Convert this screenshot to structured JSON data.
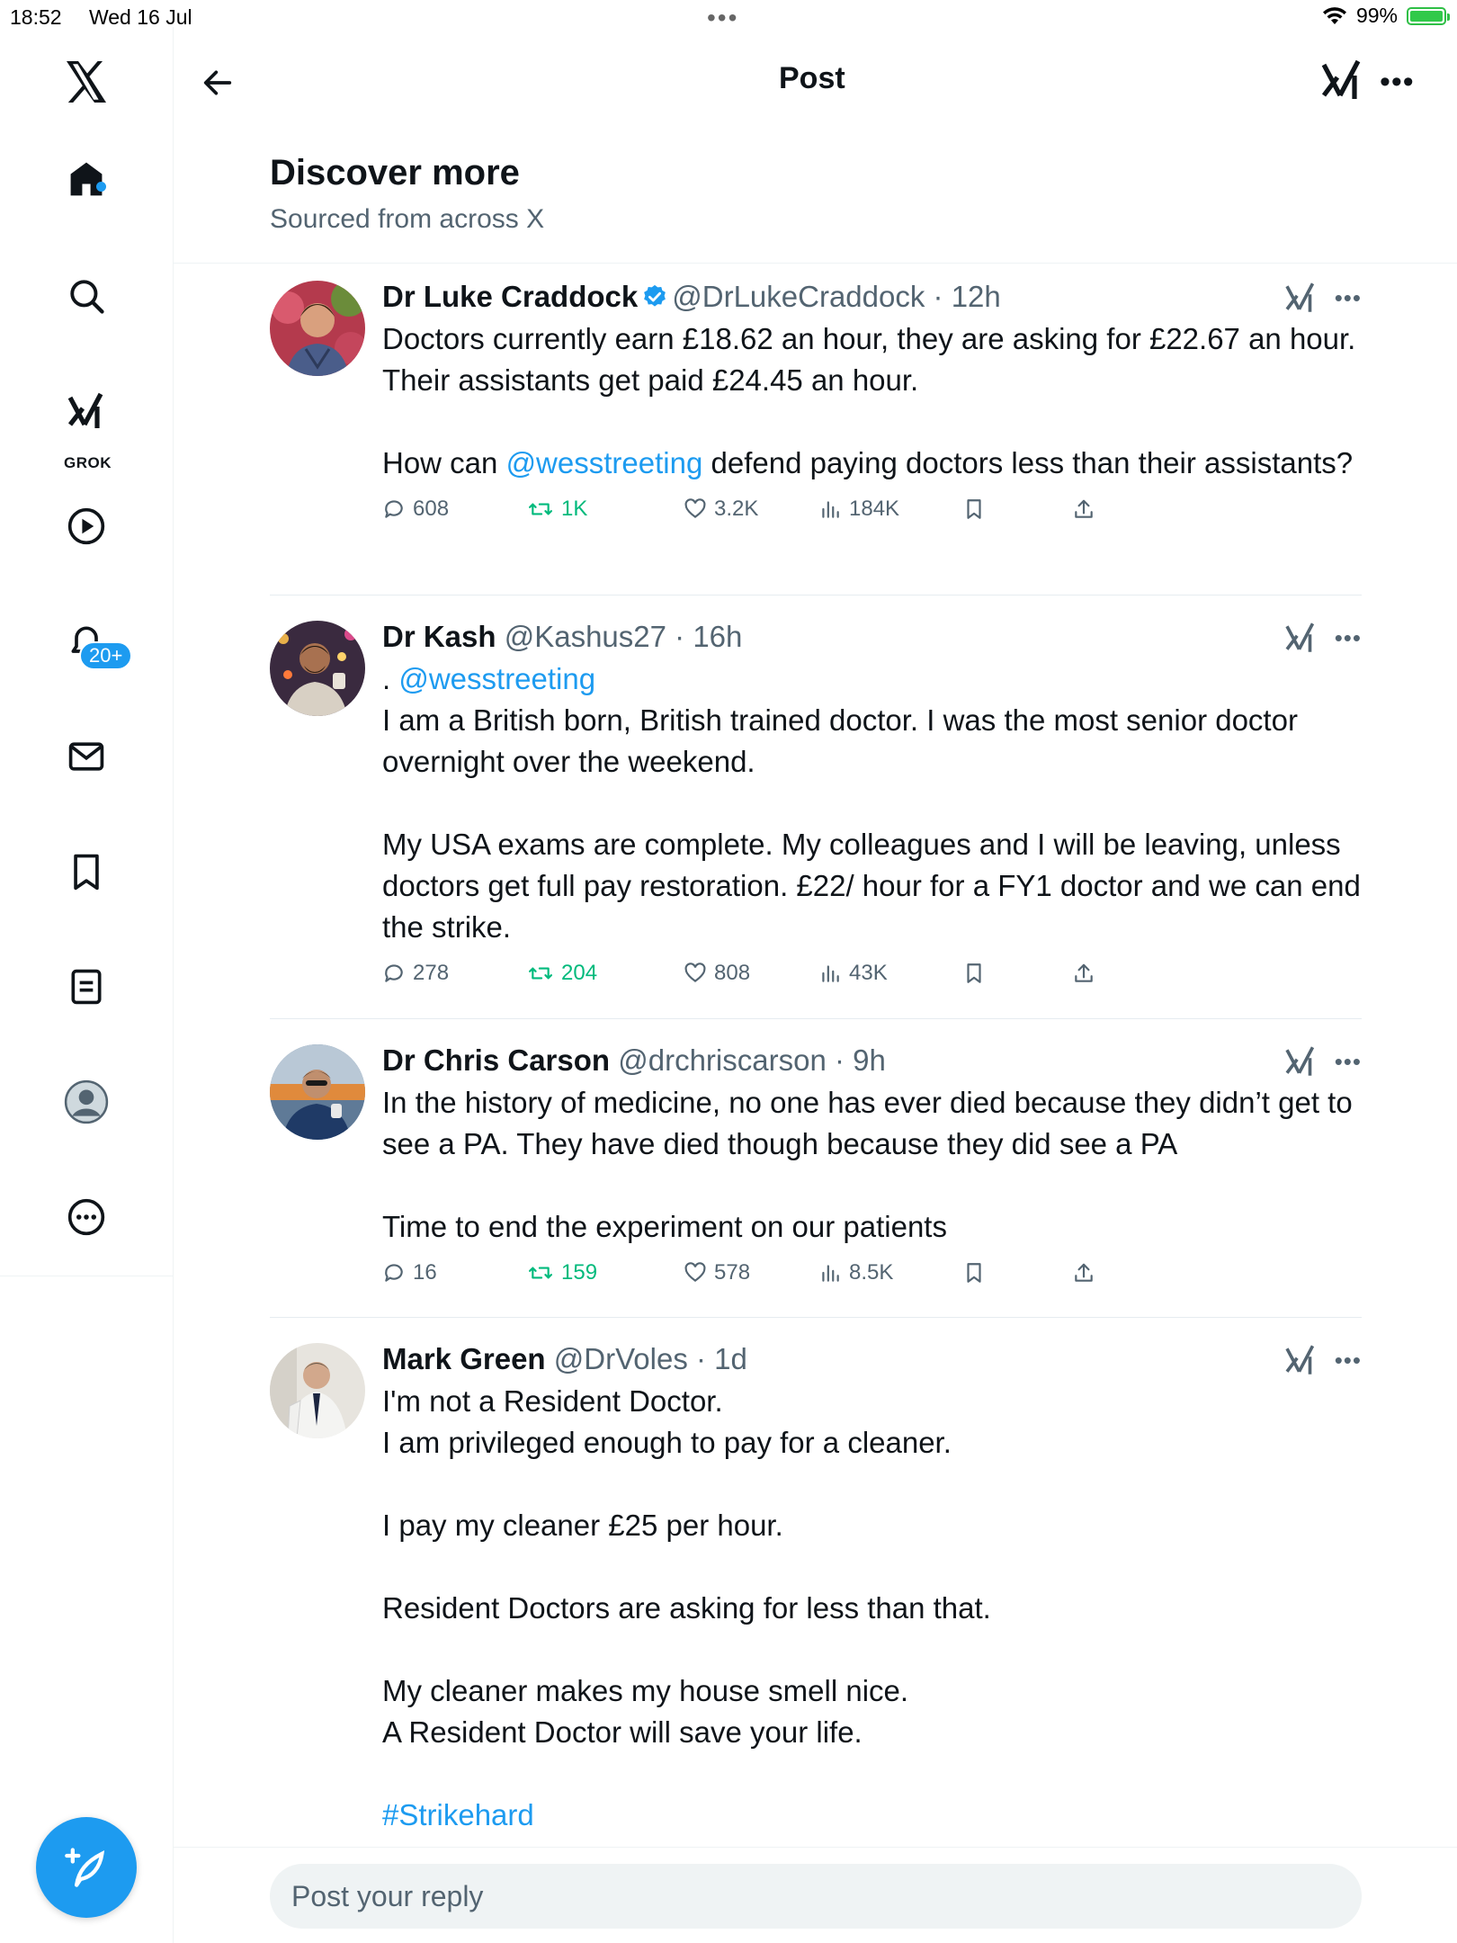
{
  "status_bar": {
    "time": "18:52",
    "date": "Wed 16 Jul",
    "battery": "99%",
    "battery_level": 0.99
  },
  "sidebar": {
    "grok_label": "GROK",
    "notifications_badge": "20+"
  },
  "header": {
    "title": "Post"
  },
  "discover": {
    "title": "Discover more",
    "subtitle": "Sourced from across X"
  },
  "posts": [
    {
      "author": "Dr Luke Craddock",
      "verified": true,
      "handle": "@DrLukeCraddock",
      "time": "12h",
      "text_a": "Doctors currently earn £18.62 an hour, they are asking for £22.67 an hour. Their assistants get paid £24.45 an hour.\n\nHow can ",
      "mention": "@wesstreeting",
      "text_b": " defend paying doctors less than their assistants?",
      "replies": "608",
      "reposts": "1K",
      "likes": "3.2K",
      "views": "184K"
    },
    {
      "author": "Dr Kash",
      "handle": "@Kashus27",
      "time": "16h",
      "text_a": ". ",
      "mention": "@wesstreeting",
      "text_b": "\nI am a British born, British trained doctor. I was the most senior doctor overnight over the weekend.\n\nMy USA exams are complete. My colleagues and I will be leaving, unless doctors get full pay restoration. £22/ hour for a FY1 doctor and we can end the strike.",
      "replies": "278",
      "reposts": "204",
      "likes": "808",
      "views": "43K"
    },
    {
      "author": "Dr Chris Carson",
      "handle": "@drchriscarson",
      "time": "9h",
      "text": "In the history of medicine, no one has ever died because they didn’t get to see a PA. They have died though because they did see a PA\n\nTime to end the experiment on our patients",
      "replies": "16",
      "reposts": "159",
      "likes": "578",
      "views": "8.5K"
    },
    {
      "author": "Mark Green",
      "handle": "@DrVoles",
      "time": "1d",
      "text": "I'm not a Resident Doctor.\nI am privileged enough to pay for a cleaner.\n\nI pay my cleaner £25 per hour.\n\nResident Doctors are asking for less than that.\n\nMy cleaner makes my house smell nice.\nA Resident Doctor will save your life.",
      "hashtag": "#Strikehard"
    }
  ],
  "reply": {
    "placeholder": "Post your reply"
  }
}
